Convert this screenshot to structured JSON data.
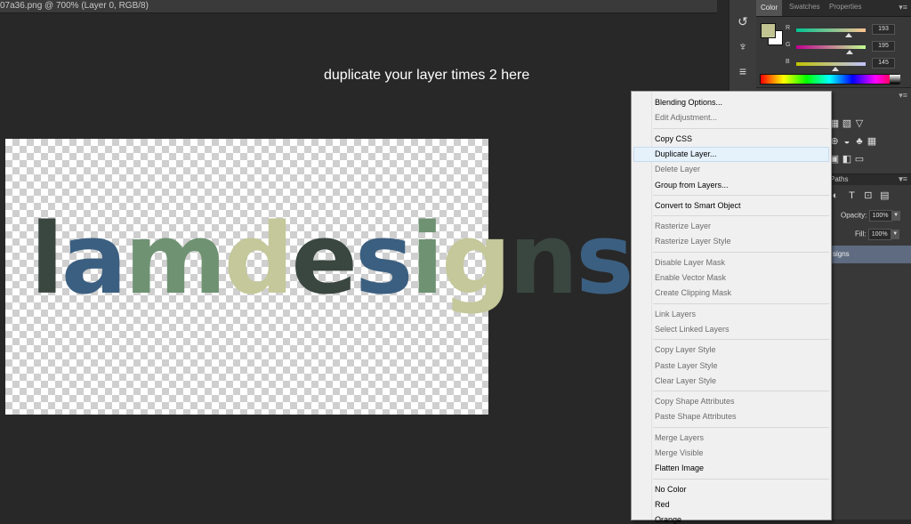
{
  "document": {
    "tab_title": "07a36.png @ 700% (Layer 0, RGB/8)"
  },
  "annotation": "duplicate your layer times 2 here",
  "canvas": {
    "logo_letters": [
      {
        "ch": "l",
        "color": "#3a4640"
      },
      {
        "ch": "a",
        "color": "#3b5f80"
      },
      {
        "ch": "m",
        "color": "#6f9273"
      },
      {
        "ch": "d",
        "color": "#c4c89a"
      },
      {
        "ch": "e",
        "color": "#3a4640"
      },
      {
        "ch": "s",
        "color": "#3b5f80"
      },
      {
        "ch": "i",
        "color": "#6f9273"
      },
      {
        "ch": "g",
        "color": "#c4c89a"
      },
      {
        "ch": "n",
        "color": "#3a4640"
      },
      {
        "ch": "s",
        "color": "#3b5f80"
      }
    ]
  },
  "color_panel": {
    "tabs": [
      "Color",
      "Swatches",
      "Properties"
    ],
    "fg_color": "#c1c391",
    "bg_color": "#ffffff",
    "channels": [
      {
        "label": "R",
        "value": "193",
        "fraction": 0.757
      },
      {
        "label": "G",
        "value": "195",
        "fraction": 0.765
      },
      {
        "label": "B",
        "value": "145",
        "fraction": 0.569
      }
    ]
  },
  "layers_panel": {
    "tab": "Paths",
    "opacity_label": "Opacity:",
    "opacity_value": "100%",
    "fill_label": "Fill:",
    "fill_value": "100%",
    "selected_layer": "signs"
  },
  "context_menu": {
    "items": [
      {
        "label": "Blending Options...",
        "enabled": true
      },
      {
        "label": "Edit Adjustment...",
        "enabled": false
      },
      {
        "sep": true
      },
      {
        "label": "Copy CSS",
        "enabled": true
      },
      {
        "label": "Duplicate Layer...",
        "enabled": true,
        "highlighted": true
      },
      {
        "label": "Delete Layer",
        "enabled": false
      },
      {
        "label": "Group from Layers...",
        "enabled": true
      },
      {
        "sep": true
      },
      {
        "label": "Convert to Smart Object",
        "enabled": true
      },
      {
        "sep": true
      },
      {
        "label": "Rasterize Layer",
        "enabled": false
      },
      {
        "label": "Rasterize Layer Style",
        "enabled": false
      },
      {
        "sep": true
      },
      {
        "label": "Disable Layer Mask",
        "enabled": false
      },
      {
        "label": "Enable Vector Mask",
        "enabled": false
      },
      {
        "label": "Create Clipping Mask",
        "enabled": false
      },
      {
        "sep": true
      },
      {
        "label": "Link Layers",
        "enabled": false
      },
      {
        "label": "Select Linked Layers",
        "enabled": false
      },
      {
        "sep": true
      },
      {
        "label": "Copy Layer Style",
        "enabled": false
      },
      {
        "label": "Paste Layer Style",
        "enabled": false
      },
      {
        "label": "Clear Layer Style",
        "enabled": false
      },
      {
        "sep": true
      },
      {
        "label": "Copy Shape Attributes",
        "enabled": false
      },
      {
        "label": "Paste Shape Attributes",
        "enabled": false
      },
      {
        "sep": true
      },
      {
        "label": "Merge Layers",
        "enabled": false
      },
      {
        "label": "Merge Visible",
        "enabled": false
      },
      {
        "label": "Flatten Image",
        "enabled": true
      },
      {
        "sep": true
      },
      {
        "label": "No Color",
        "enabled": true
      },
      {
        "label": "Red",
        "enabled": true
      },
      {
        "label": "Orange",
        "enabled": true
      }
    ]
  },
  "tool_icons": [
    "brush-preset-icon",
    "clone-source-icon",
    "adjustments-icon"
  ]
}
